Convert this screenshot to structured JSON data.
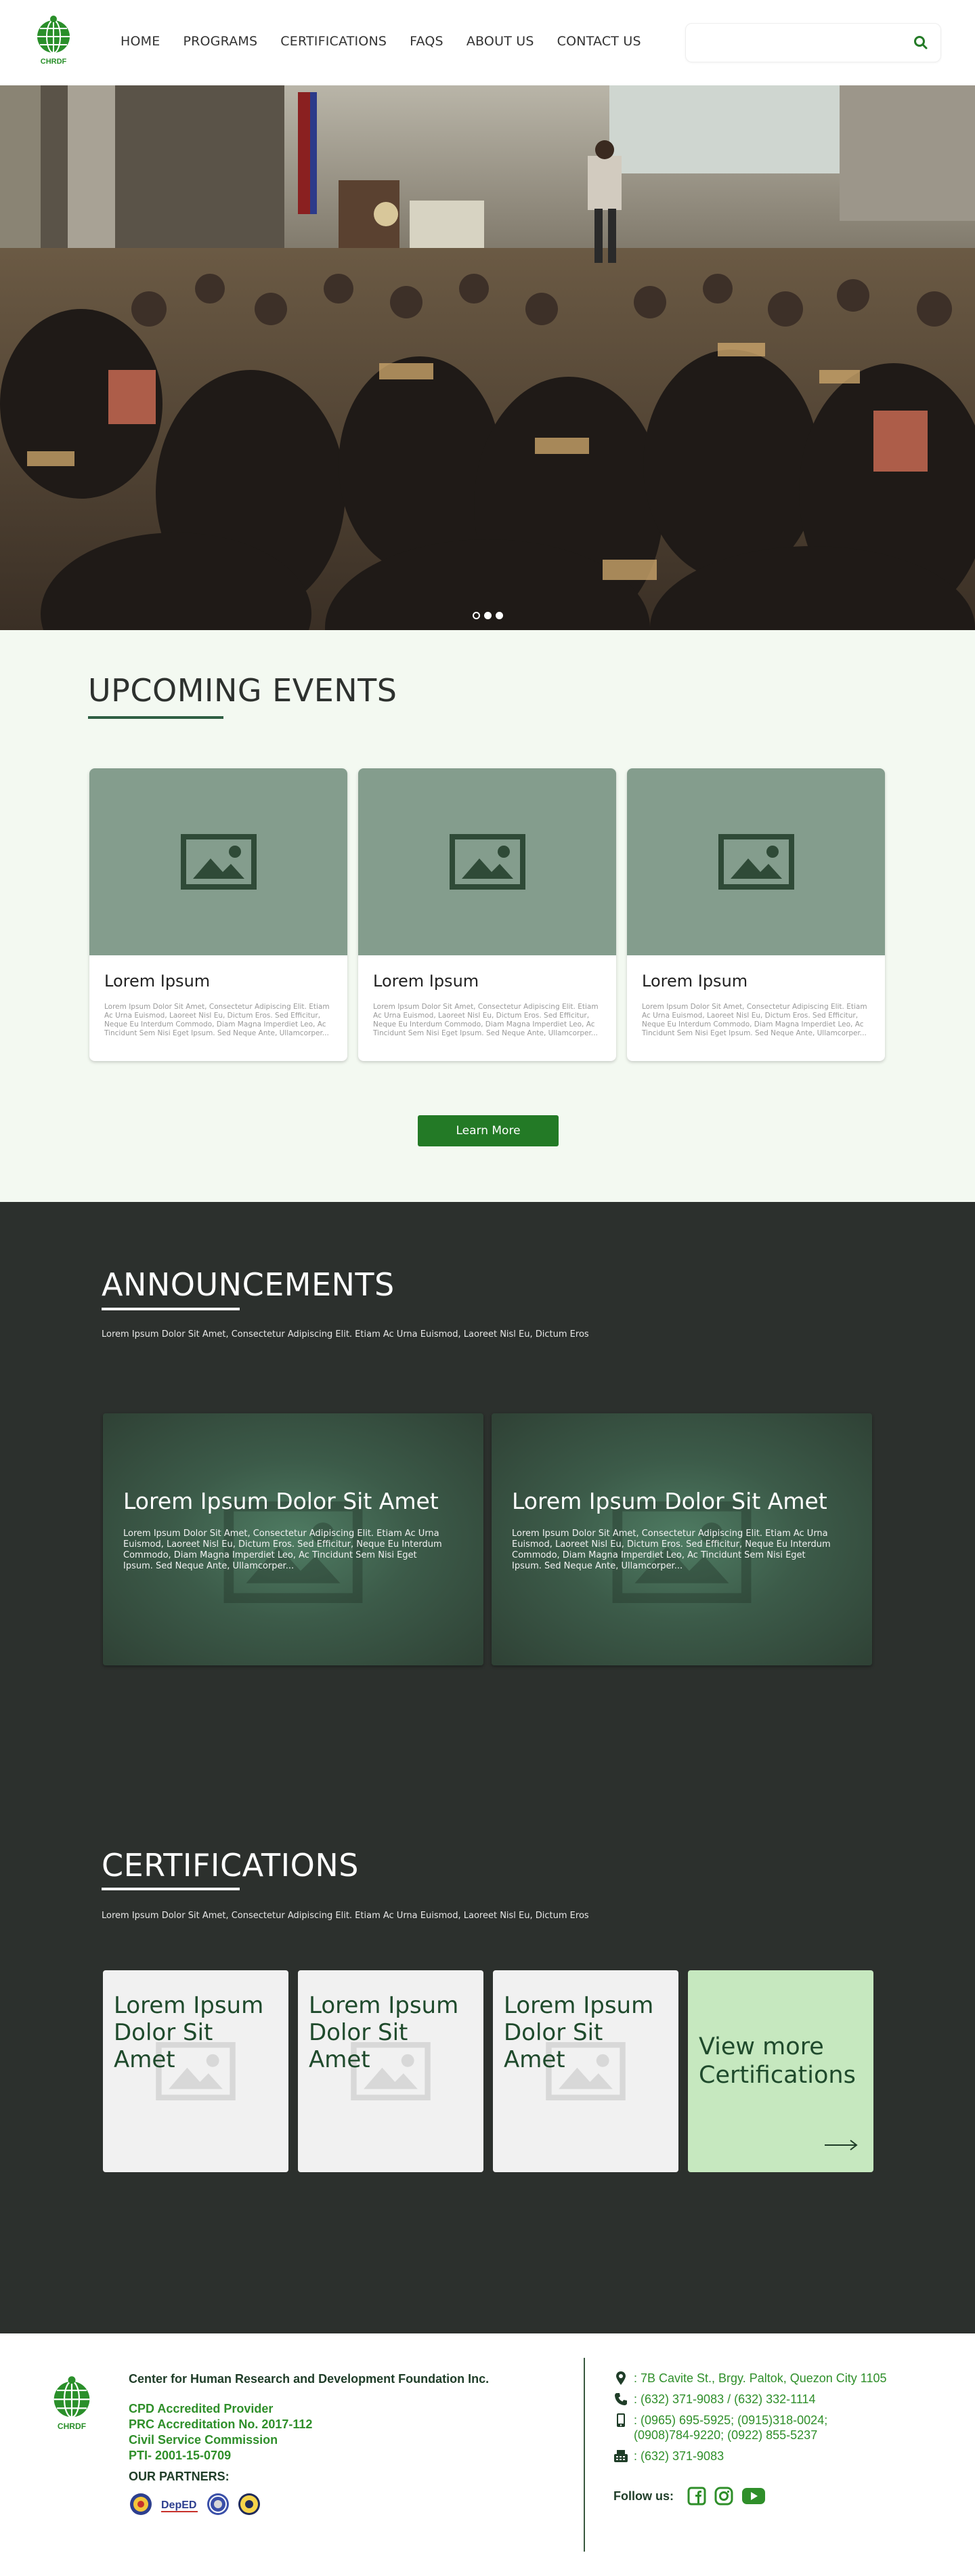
{
  "nav": {
    "logo_text": "CHRDF",
    "links": [
      "HOME",
      "PROGRAMS",
      "CERTIFICATIONS",
      "FAQS",
      "ABOUT US",
      "CONTACT US"
    ],
    "search_placeholder": ""
  },
  "hero": {
    "slide_count": 3,
    "active_slide": 1
  },
  "events": {
    "title": "UPCOMING EVENTS",
    "cards": [
      {
        "title": "Lorem Ipsum",
        "text": "Lorem Ipsum Dolor Sit Amet, Consectetur Adipiscing Elit. Etiam Ac Urna Euismod, Laoreet Nisl Eu, Dictum Eros. Sed Efficitur, Neque Eu Interdum Commodo, Diam Magna Imperdiet Leo, Ac Tincidunt Sem Nisi Eget Ipsum. Sed Neque Ante, Ullamcorper..."
      },
      {
        "title": "Lorem Ipsum",
        "text": "Lorem Ipsum Dolor Sit Amet, Consectetur Adipiscing Elit. Etiam Ac Urna Euismod, Laoreet Nisl Eu, Dictum Eros. Sed Efficitur, Neque Eu Interdum Commodo, Diam Magna Imperdiet Leo, Ac Tincidunt Sem Nisi Eget Ipsum. Sed Neque Ante, Ullamcorper..."
      },
      {
        "title": "Lorem Ipsum",
        "text": "Lorem Ipsum Dolor Sit Amet, Consectetur Adipiscing Elit. Etiam Ac Urna Euismod, Laoreet Nisl Eu, Dictum Eros. Sed Efficitur, Neque Eu Interdum Commodo, Diam Magna Imperdiet Leo, Ac Tincidunt Sem Nisi Eget Ipsum. Sed Neque Ante, Ullamcorper..."
      }
    ],
    "button": "Learn More"
  },
  "announcements": {
    "title": "ANNOUNCEMENTS",
    "subtitle": "Lorem Ipsum Dolor Sit Amet, Consectetur Adipiscing Elit. Etiam Ac Urna Euismod, Laoreet Nisl Eu, Dictum Eros",
    "cards": [
      {
        "title": "Lorem Ipsum Dolor Sit Amet",
        "text": "Lorem Ipsum Dolor Sit Amet, Consectetur Adipiscing Elit. Etiam Ac Urna Euismod, Laoreet Nisl Eu, Dictum Eros. Sed Efficitur, Neque Eu Interdum Commodo, Diam Magna Imperdiet Leo, Ac Tincidunt Sem Nisi Eget Ipsum. Sed Neque Ante, Ullamcorper..."
      },
      {
        "title": "Lorem Ipsum Dolor Sit Amet",
        "text": "Lorem Ipsum Dolor Sit Amet, Consectetur Adipiscing Elit. Etiam Ac Urna Euismod, Laoreet Nisl Eu, Dictum Eros. Sed Efficitur, Neque Eu Interdum Commodo, Diam Magna Imperdiet Leo, Ac Tincidunt Sem Nisi Eget Ipsum. Sed Neque Ante, Ullamcorper..."
      }
    ]
  },
  "certifications": {
    "title": "CERTIFICATIONS",
    "subtitle": "Lorem Ipsum Dolor Sit Amet, Consectetur Adipiscing Elit. Etiam Ac Urna Euismod, Laoreet Nisl Eu, Dictum Eros",
    "cards": [
      {
        "title": "Lorem Ipsum Dolor Sit Amet"
      },
      {
        "title": "Lorem Ipsum Dolor Sit Amet"
      },
      {
        "title": "Lorem Ipsum Dolor Sit Amet"
      }
    ],
    "more": "View more Certifications"
  },
  "footer": {
    "logo_text": "CHRDF",
    "org_name": "Center for Human Research and Development Foundation Inc.",
    "accreditations": [
      "CPD Accredited Provider",
      "PRC Accreditation No. 2017-112",
      "Civil Service Commission",
      "PTI- 2001-15-0709"
    ],
    "partners_label": "OUR PARTNERS:",
    "partner_2_text": "DepED",
    "address": ": 7B Cavite St., Brgy. Paltok, Quezon City 1105",
    "phone": ": (632) 371-9083 / (632) 332-1114",
    "mobile_1": ": (0965) 695-5925; (0915)318-0024;",
    "mobile_2": "(0908)784-9220; (0922) 855-5237",
    "fax": ": (632) 371-9083",
    "follow_label": "Follow us:"
  },
  "colors": {
    "brand_green": "#237a26",
    "dark_bg": "#2c302d",
    "events_bg": "#f3f9f1",
    "card_image": "#849d8d",
    "cert_more_bg": "#c6e8bf",
    "footer_green": "#2f8f2a"
  }
}
